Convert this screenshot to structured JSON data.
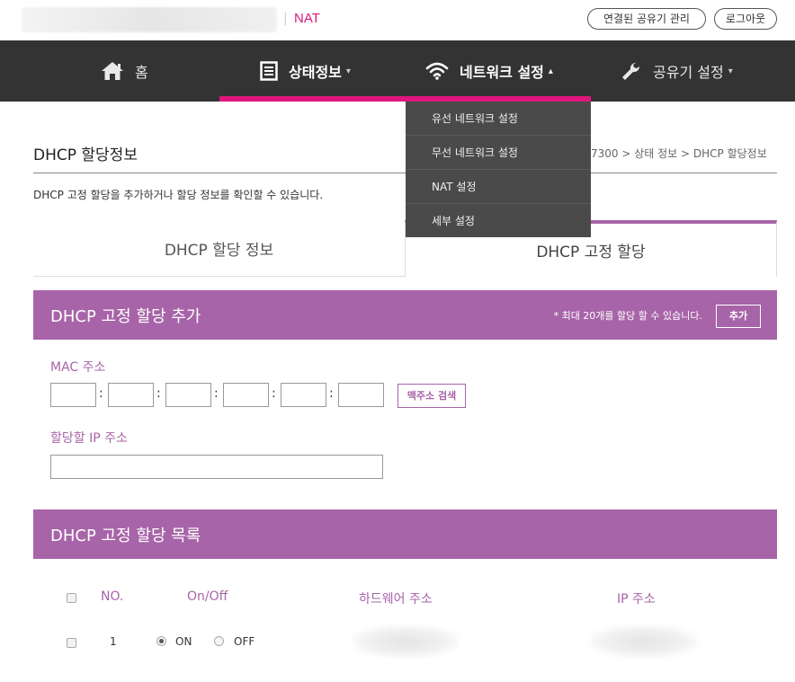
{
  "header": {
    "separator": "|",
    "section_title": "NAT",
    "manage_label": "연결된 공유기 관리",
    "logout_label": "로그아웃"
  },
  "nav": {
    "items": [
      {
        "label": "홈",
        "icon": "home-icon"
      },
      {
        "label": "상태정보",
        "icon": "document-icon"
      },
      {
        "label": "네트워크 설정",
        "icon": "wifi-icon"
      },
      {
        "label": "공유기 설정",
        "icon": "wrench-icon"
      }
    ],
    "caret_down": "▾",
    "caret_up": "▴",
    "active_index": 2,
    "accent_color": "#e0157d"
  },
  "dropdown": {
    "items": [
      "유선 네트워크 설정",
      "무선 네트워크 설정",
      "NAT 설정",
      "세부 설정"
    ]
  },
  "page": {
    "title": "DHCP 할당정보",
    "breadcrumb": "7300 > 상태 정보 > DHCP 할당정보",
    "description": "DHCP 고정 할당을 추가하거나 할당 정보를 확인할 수 있습니다."
  },
  "tabs": {
    "items": [
      "DHCP 할당 정보",
      "DHCP 고정 할당"
    ],
    "active_index": 1
  },
  "add_section": {
    "title": "DHCP 고정 할당 추가",
    "note": "* 최대 20개를 할당 할 수 있습니다.",
    "add_label": "추가",
    "mac_label": "MAC 주소",
    "colon": ":",
    "mac_search_label": "맥주소 검색",
    "ip_label": "할당할 IP 주소",
    "bar_color": "#a764a8"
  },
  "list_section": {
    "title": "DHCP 고정 할당 목록",
    "columns": [
      "NO.",
      "On/Off",
      "하드웨어 주소",
      "IP 주소"
    ],
    "rows": [
      {
        "no": "1",
        "on_label": "ON",
        "off_label": "OFF",
        "selected": "ON"
      }
    ]
  }
}
